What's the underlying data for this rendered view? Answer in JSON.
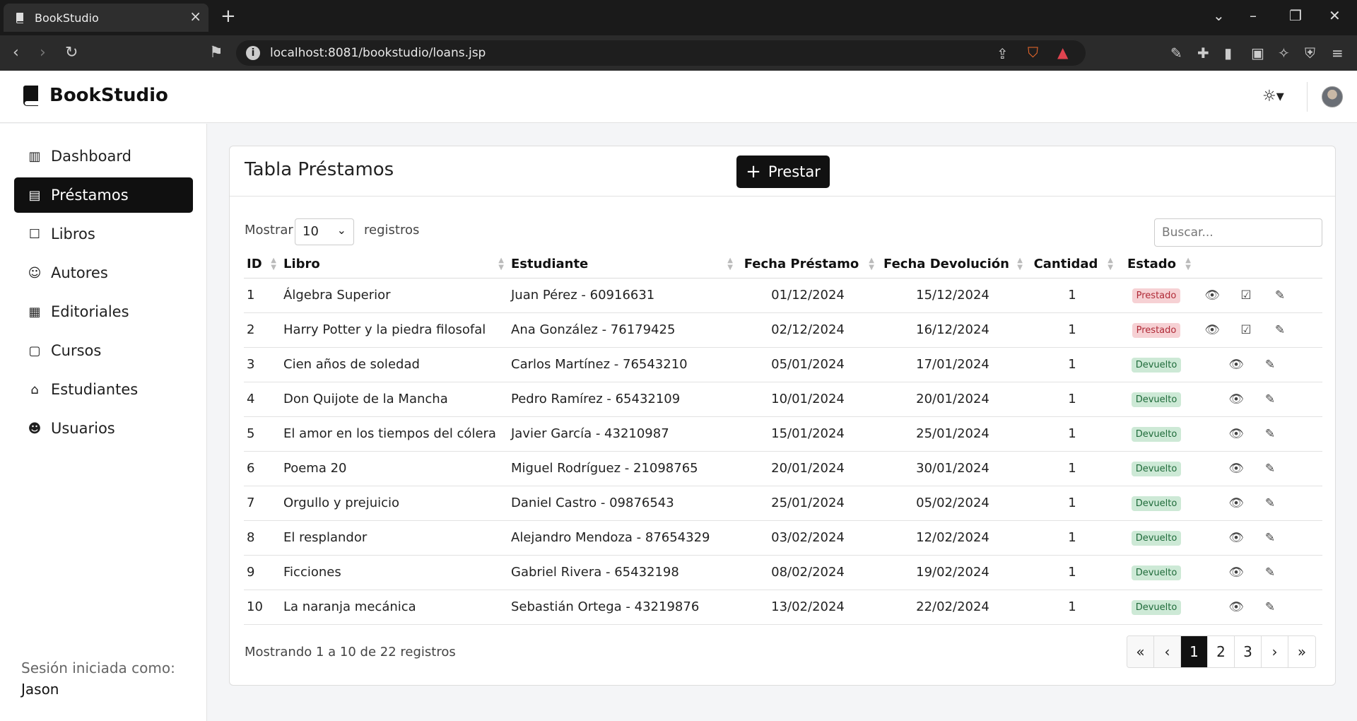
{
  "browser": {
    "tab_title": "BookStudio",
    "url": "localhost:8081/bookstudio/loans.jsp"
  },
  "app": {
    "brand": "BookStudio"
  },
  "sidebar": {
    "items": [
      {
        "label": "Dashboard",
        "icon": "chart-icon",
        "glyph": "▥"
      },
      {
        "label": "Préstamos",
        "icon": "file-icon",
        "glyph": "▤"
      },
      {
        "label": "Libros",
        "icon": "book-icon",
        "glyph": "☐"
      },
      {
        "label": "Autores",
        "icon": "user-plus-icon",
        "glyph": "☺"
      },
      {
        "label": "Editoriales",
        "icon": "map-icon",
        "glyph": "▦"
      },
      {
        "label": "Cursos",
        "icon": "sticky-note-icon",
        "glyph": "▢"
      },
      {
        "label": "Estudiantes",
        "icon": "mortarboard-icon",
        "glyph": "⌂"
      },
      {
        "label": "Usuarios",
        "icon": "users-icon",
        "glyph": "☻"
      }
    ],
    "session_label": "Sesión iniciada como:",
    "session_user": "Jason"
  },
  "main": {
    "title": "Tabla Préstamos",
    "add_button": "Prestar",
    "length_label_pre": "Mostrar",
    "length_value": "10",
    "length_label_post": "registros",
    "search_placeholder": "Buscar...",
    "columns": [
      "ID",
      "Libro",
      "Estudiante",
      "Fecha Préstamo",
      "Fecha Devolución",
      "Cantidad",
      "Estado"
    ],
    "rows": [
      {
        "id": "1",
        "book": "Álgebra Superior",
        "student": "Juan Pérez - 60916631",
        "loan": "01/12/2024",
        "ret": "15/12/2024",
        "qty": "1",
        "status": "Prestado"
      },
      {
        "id": "2",
        "book": "Harry Potter y la piedra filosofal",
        "student": "Ana González - 76179425",
        "loan": "02/12/2024",
        "ret": "16/12/2024",
        "qty": "1",
        "status": "Prestado"
      },
      {
        "id": "3",
        "book": "Cien años de soledad",
        "student": "Carlos Martínez - 76543210",
        "loan": "05/01/2024",
        "ret": "17/01/2024",
        "qty": "1",
        "status": "Devuelto"
      },
      {
        "id": "4",
        "book": "Don Quijote de la Mancha",
        "student": "Pedro Ramírez - 65432109",
        "loan": "10/01/2024",
        "ret": "20/01/2024",
        "qty": "1",
        "status": "Devuelto"
      },
      {
        "id": "5",
        "book": "El amor en los tiempos del cólera",
        "student": "Javier García - 43210987",
        "loan": "15/01/2024",
        "ret": "25/01/2024",
        "qty": "1",
        "status": "Devuelto"
      },
      {
        "id": "6",
        "book": "Poema 20",
        "student": "Miguel Rodríguez - 21098765",
        "loan": "20/01/2024",
        "ret": "30/01/2024",
        "qty": "1",
        "status": "Devuelto"
      },
      {
        "id": "7",
        "book": "Orgullo y prejuicio",
        "student": "Daniel Castro - 09876543",
        "loan": "25/01/2024",
        "ret": "05/02/2024",
        "qty": "1",
        "status": "Devuelto"
      },
      {
        "id": "8",
        "book": "El resplandor",
        "student": "Alejandro Mendoza - 87654329",
        "loan": "03/02/2024",
        "ret": "12/02/2024",
        "qty": "1",
        "status": "Devuelto"
      },
      {
        "id": "9",
        "book": "Ficciones",
        "student": "Gabriel Rivera - 65432198",
        "loan": "08/02/2024",
        "ret": "19/02/2024",
        "qty": "1",
        "status": "Devuelto"
      },
      {
        "id": "10",
        "book": "La naranja mecánica",
        "student": "Sebastián Ortega - 43219876",
        "loan": "13/02/2024",
        "ret": "22/02/2024",
        "qty": "1",
        "status": "Devuelto"
      }
    ],
    "info": "Mostrando 1 a 10 de 22 registros",
    "pagination": [
      "«",
      "‹",
      "1",
      "2",
      "3",
      "›",
      "»"
    ],
    "current_page": "1"
  }
}
